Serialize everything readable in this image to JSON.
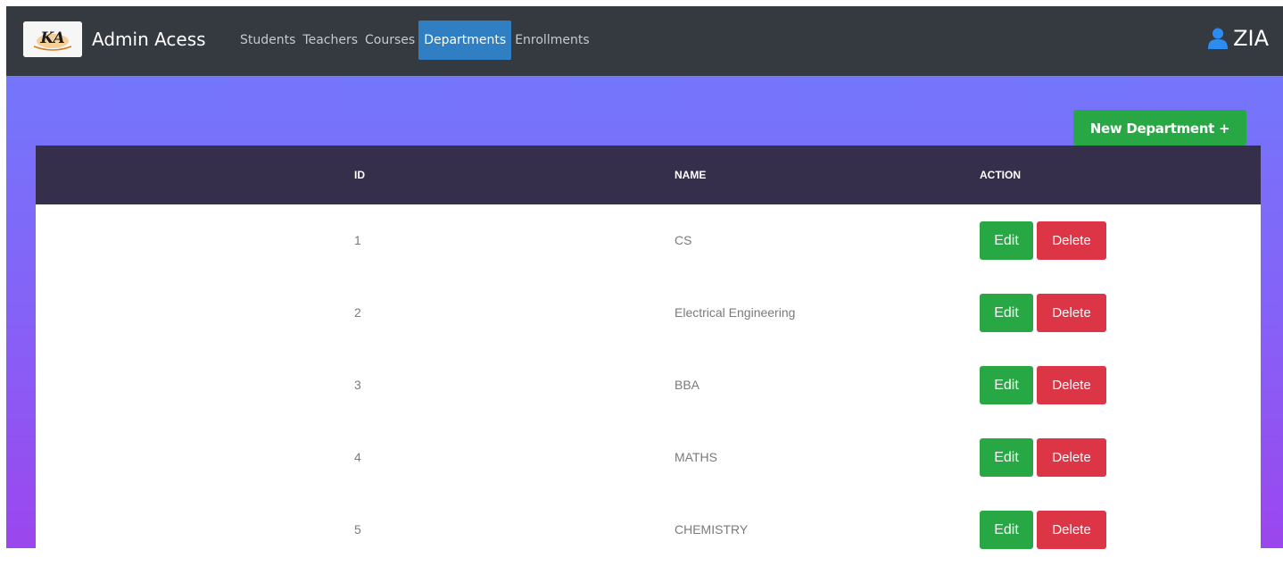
{
  "header": {
    "brand_logo_text": "KA",
    "brand_title": "Admin Acess",
    "nav": [
      {
        "label": "Students",
        "active": false
      },
      {
        "label": "Teachers",
        "active": false
      },
      {
        "label": "Courses",
        "active": false
      },
      {
        "label": "Departments",
        "active": true
      },
      {
        "label": "Enrollments",
        "active": false
      }
    ],
    "user": {
      "icon": "user-icon",
      "name": "ZIA"
    }
  },
  "toolbar": {
    "new_department_label": "New Department +"
  },
  "table": {
    "headers": {
      "id": "ID",
      "name": "NAME",
      "action": "ACTION"
    },
    "rows": [
      {
        "id": "1",
        "name": "CS"
      },
      {
        "id": "2",
        "name": "Electrical Engineering"
      },
      {
        "id": "3",
        "name": "BBA"
      },
      {
        "id": "4",
        "name": "MATHS"
      },
      {
        "id": "5",
        "name": "CHEMISTRY"
      }
    ],
    "edit_label": "Edit",
    "delete_label": "Delete"
  },
  "colors": {
    "topbar": "#343a40",
    "active_nav": "#2f7fc2",
    "table_header": "#352f4b",
    "success": "#28a745",
    "danger": "#dc3545",
    "gradient_top": "#7476fb",
    "gradient_bottom": "#9b46ee"
  }
}
